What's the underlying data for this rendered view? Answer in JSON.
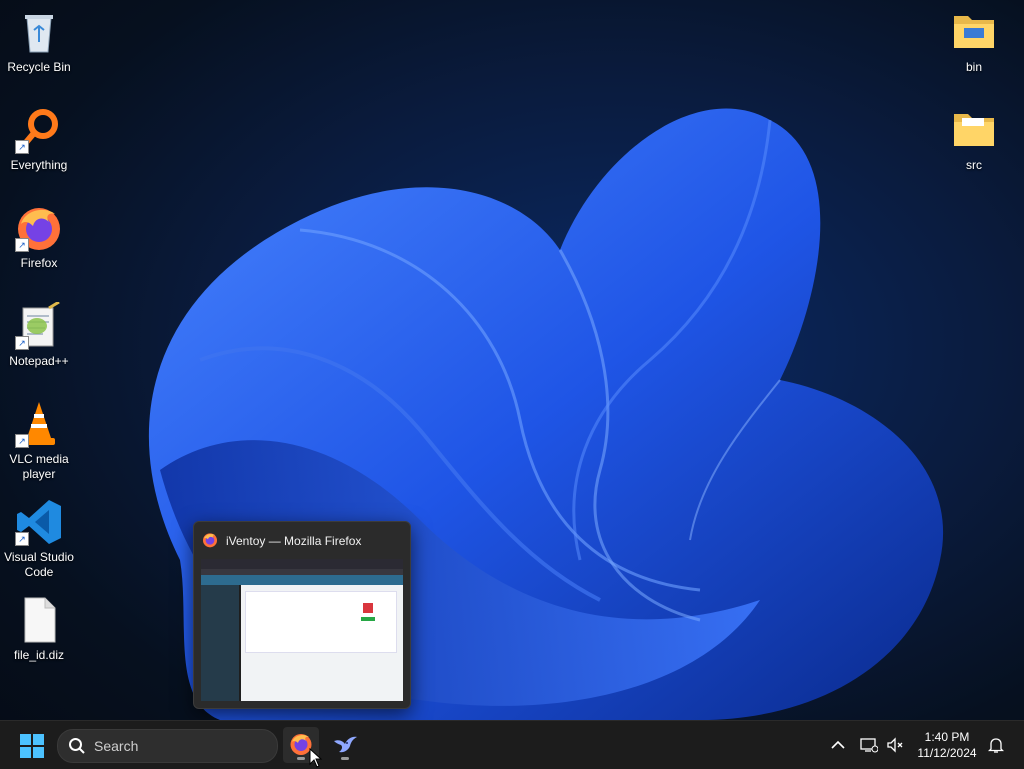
{
  "desktop": {
    "left_icons": [
      {
        "id": "recycle-bin",
        "label": "Recycle Bin",
        "shortcut": false
      },
      {
        "id": "everything",
        "label": "Everything",
        "shortcut": true
      },
      {
        "id": "firefox",
        "label": "Firefox",
        "shortcut": true
      },
      {
        "id": "notepadpp",
        "label": "Notepad++",
        "shortcut": true
      },
      {
        "id": "vlc",
        "label": "VLC media player",
        "shortcut": true
      },
      {
        "id": "vscode",
        "label": "Visual Studio Code",
        "shortcut": true
      },
      {
        "id": "file-id-diz",
        "label": "file_id.diz",
        "shortcut": false
      }
    ],
    "right_icons": [
      {
        "id": "bin-folder",
        "label": "bin"
      },
      {
        "id": "src-folder",
        "label": "src"
      }
    ]
  },
  "preview": {
    "title": "iVentoy — Mozilla Firefox"
  },
  "taskbar": {
    "search_placeholder": "Search",
    "time": "1:40 PM",
    "date": "11/12/2024"
  },
  "colors": {
    "accent": "#0078d4",
    "taskbar": "#1c1c1c",
    "wallpaper_blue": "#1f55e6"
  }
}
